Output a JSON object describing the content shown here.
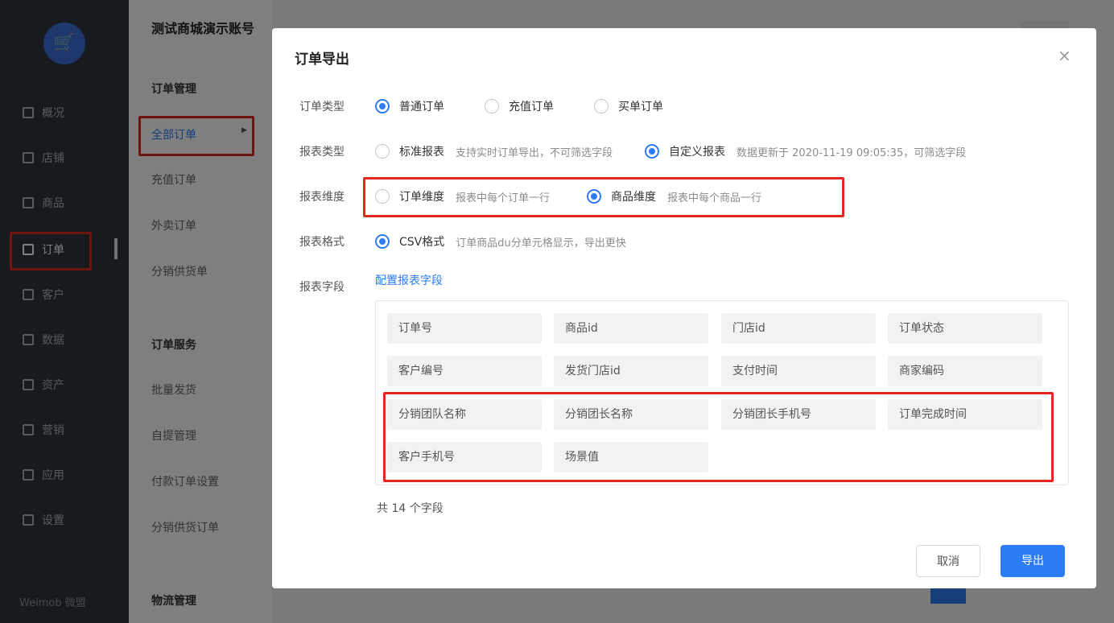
{
  "app": {
    "shop_name": "测试商城演示账号",
    "footer_brand": "Weimob 微盟",
    "nav": [
      {
        "label": "概况"
      },
      {
        "label": "店铺"
      },
      {
        "label": "商品"
      },
      {
        "label": "订单"
      },
      {
        "label": "客户"
      },
      {
        "label": "数据"
      },
      {
        "label": "资产"
      },
      {
        "label": "营销"
      },
      {
        "label": "应用"
      },
      {
        "label": "设置"
      }
    ],
    "sub_nav": {
      "group1": "订单管理",
      "items1": [
        "全部订单",
        "充值订单",
        "外卖订单",
        "分销供货单"
      ],
      "group2": "订单服务",
      "items2": [
        "批量发货",
        "自提管理",
        "付款订单设置",
        "分销供货订单"
      ],
      "group3": "物流管理"
    }
  },
  "dialog": {
    "title": "订单导出",
    "close": "×",
    "order_type": {
      "label": "订单类型",
      "options": [
        "普通订单",
        "充值订单",
        "买单订单"
      ],
      "selected": "普通订单"
    },
    "report_type": {
      "label": "报表类型",
      "options": [
        {
          "label": "标准报表",
          "hint": "支持实时订单导出，不可筛选字段"
        },
        {
          "label": "自定义报表",
          "hint": "数据更新于 2020-11-19 09:05:35，可筛选字段"
        }
      ],
      "selected": "自定义报表"
    },
    "report_dimension": {
      "label": "报表维度",
      "options": [
        {
          "label": "订单维度",
          "hint": "报表中每个订单一行"
        },
        {
          "label": "商品维度",
          "hint": "报表中每个商品一行"
        }
      ],
      "selected": "商品维度"
    },
    "report_format": {
      "label": "报表格式",
      "option": "CSV格式",
      "hint": "订单商品du分单元格显示，导出更快"
    },
    "report_fields": {
      "label": "报表字段",
      "config_link": "配置报表字段",
      "fields": [
        "订单号",
        "商品id",
        "门店id",
        "订单状态",
        "客户编号",
        "发货门店id",
        "支付时间",
        "商家编码",
        "分销团队名称",
        "分销团长名称",
        "分销团长手机号",
        "订单完成时间",
        "客户手机号",
        "场景值"
      ],
      "count_text": "共 14 个字段"
    },
    "buttons": {
      "cancel": "取消",
      "export": "导出"
    },
    "accent": "#2b7cf6",
    "highlight": "#e0281f"
  }
}
